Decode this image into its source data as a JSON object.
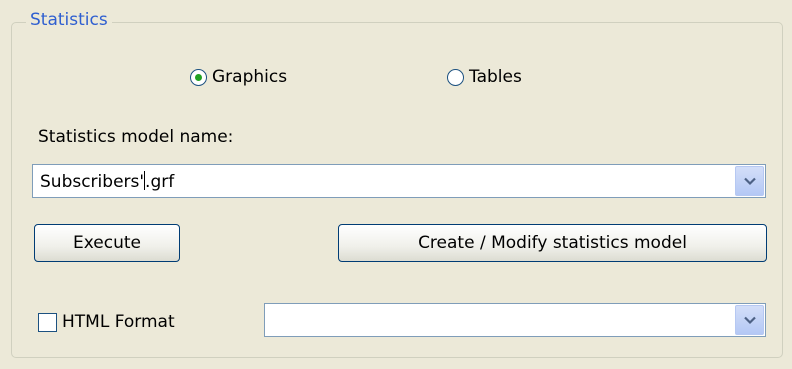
{
  "group": {
    "title": "Statistics"
  },
  "output_type": {
    "options": [
      {
        "label": "Graphics",
        "selected": true
      },
      {
        "label": "Tables",
        "selected": false
      }
    ]
  },
  "model": {
    "label": "Statistics model name:",
    "value_before_cursor": "Subscribers'",
    "value_after_cursor": ".grf",
    "dropdown_icon": "chevron-down-icon"
  },
  "buttons": {
    "execute": "Execute",
    "create_modify": "Create / Modify statistics model"
  },
  "html_format": {
    "label": "HTML Format",
    "checked": false,
    "selected_value": ""
  },
  "colors": {
    "title_blue": "#2f5fd0",
    "radio_dot": "#21a121",
    "window_bg": "#ece9d8"
  }
}
